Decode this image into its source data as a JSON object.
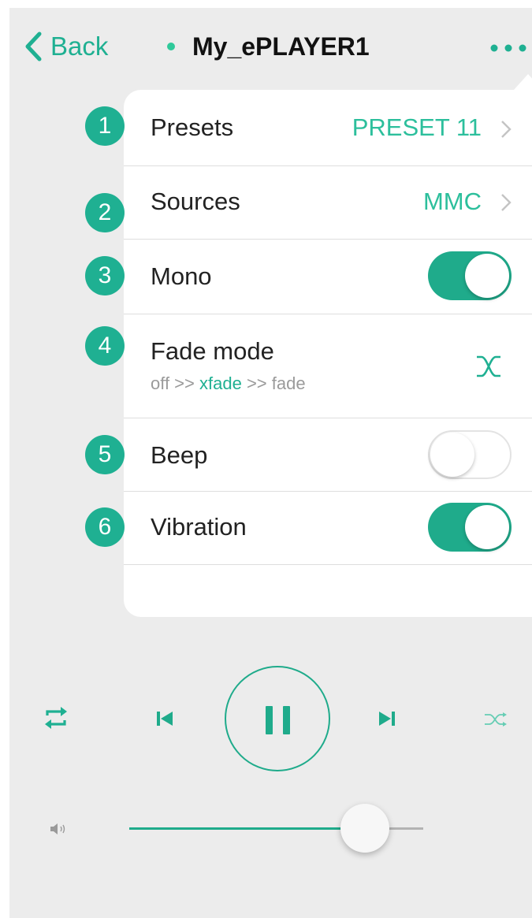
{
  "header": {
    "back_label": "Back",
    "device_name": "My_ePLAYER1",
    "status_color": "#2fc99a",
    "more_icon": "more-dots-icon"
  },
  "settings_menu": [
    {
      "number": "1",
      "label": "Presets",
      "value": "PRESET 11",
      "control": "chevron"
    },
    {
      "number": "2",
      "label": "Sources",
      "value": "MMC",
      "control": "chevron"
    },
    {
      "number": "3",
      "label": "Mono",
      "control": "toggle",
      "state": "on"
    },
    {
      "number": "4",
      "label": "Fade mode",
      "sub_prefix": "off >>",
      "sub_active": "xfade",
      "sub_suffix": ">> fade",
      "control": "fade-mode-icon"
    },
    {
      "number": "5",
      "label": "Beep",
      "control": "toggle",
      "state": "off"
    },
    {
      "number": "6",
      "label": "Vibration",
      "control": "toggle",
      "state": "on"
    }
  ],
  "player": {
    "icons": [
      "repeat-icon",
      "previous-track-icon",
      "pause-icon",
      "next-track-icon",
      "shuffle-icon"
    ],
    "play_state": "playing",
    "volume_level": 0.8,
    "volume_icon": "volume-icon"
  },
  "colors": {
    "accent": "#1fb092",
    "toggle_on": "#1fab8b",
    "background": "#ececec"
  }
}
